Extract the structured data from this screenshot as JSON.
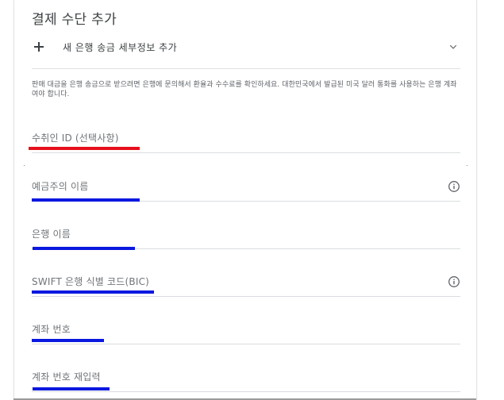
{
  "page": {
    "title": "결제 수단 추가",
    "add_bank_label": "새 은행 송금 세부정보 추가",
    "info_text": "판매 대금을 은행 송금으로 받으려면 은행에 문의해서 환율과 수수료를 확인하세요. 대한민국에서 발급된 미국 달러 통화를 사용하는 은행 계좌여야 합니다."
  },
  "fields": {
    "payee_id": "수취인 ID (선택사항)",
    "account_holder": "예금주의 이름",
    "bank_name": "은행 이름",
    "swift": "SWIFT 은행 식별 코드(BIC)",
    "account_number": "계좌 번호",
    "account_number_confirm": "계좌 번호 재입력"
  },
  "colors": {
    "highlight_red": "#e8101d",
    "highlight_blue": "#0a18e0",
    "text": "#3c4043",
    "label": "#70757a",
    "divider": "#dadce0"
  },
  "icons": {
    "add": "plus-icon",
    "expand": "chevron-down-icon",
    "info": "info-icon"
  }
}
